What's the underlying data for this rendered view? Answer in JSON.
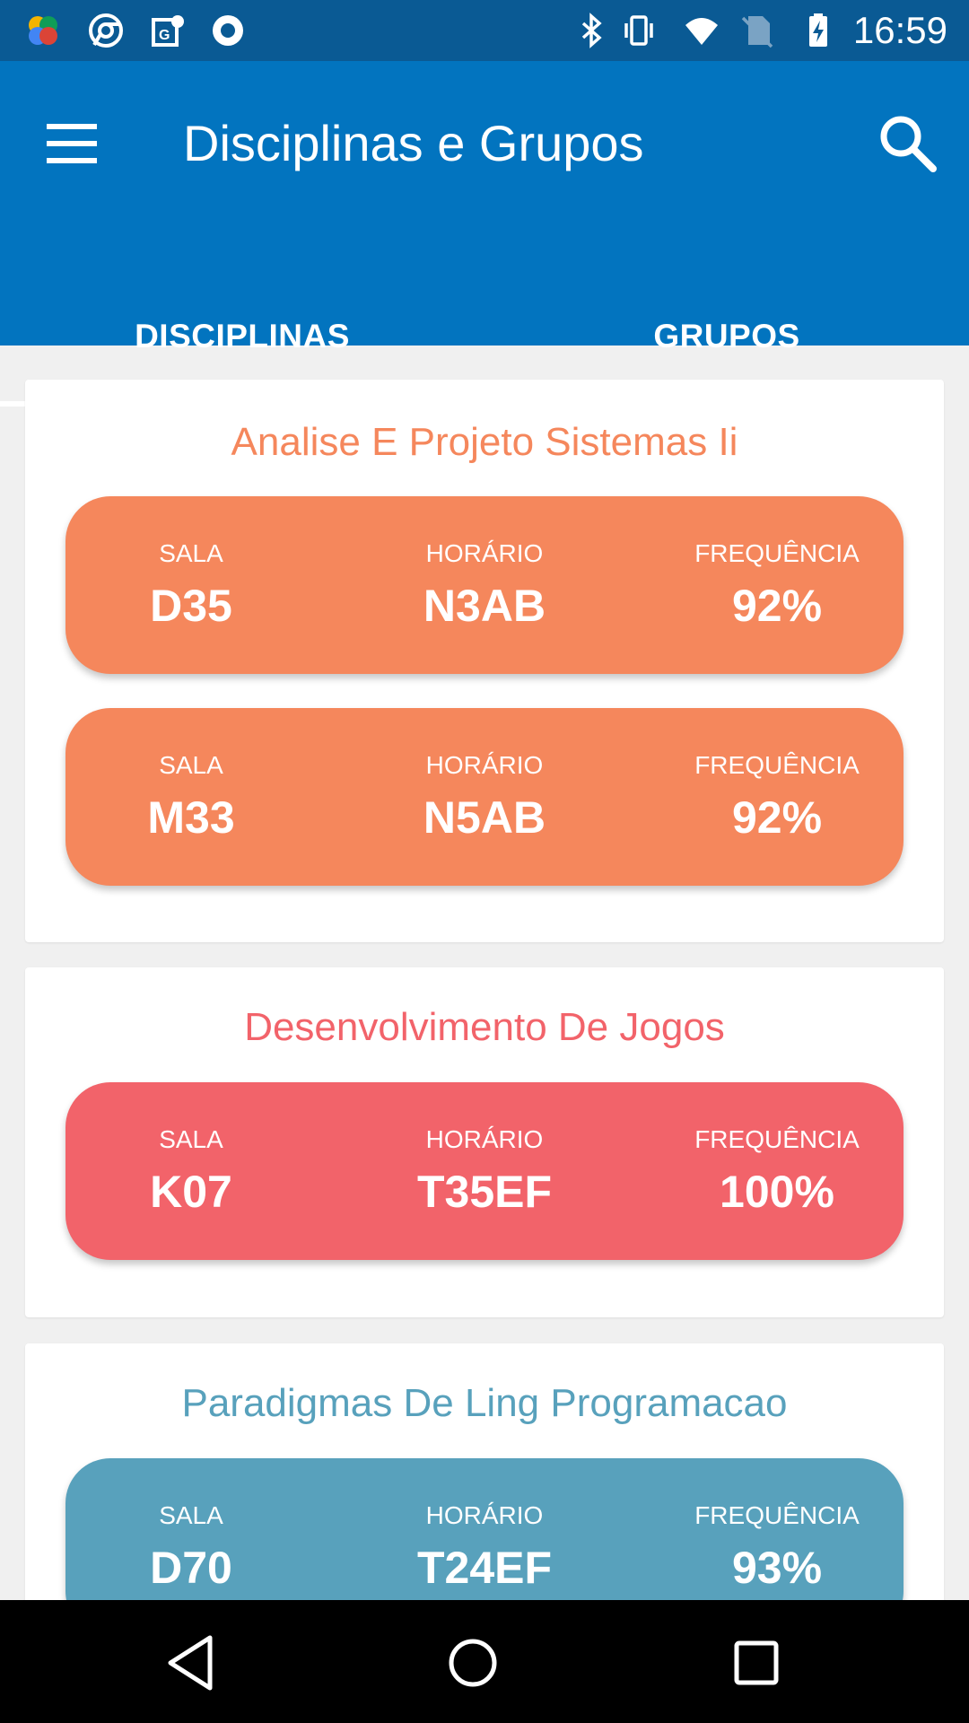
{
  "status_bar": {
    "time": "16:59",
    "left_icons": [
      "app-icon",
      "chrome-icon",
      "maps-icon",
      "record-icon"
    ],
    "right_icons": [
      "bluetooth-icon",
      "vibrate-icon",
      "wifi-icon",
      "no-sim-icon",
      "battery-icon"
    ]
  },
  "appbar": {
    "title": "Disciplinas e Grupos",
    "menu_icon": "menu-icon",
    "search_icon": "search-icon"
  },
  "tabs": [
    {
      "label": "DISCIPLINAS",
      "active": true
    },
    {
      "label": "GRUPOS",
      "active": false
    }
  ],
  "courses": [
    {
      "title": "Analise E Projeto Sistemas Ii",
      "color": "#f5875c",
      "slots": [
        {
          "sala_label": "SALA",
          "sala": "D35",
          "horario_label": "HORÁRIO",
          "horario": "N3AB",
          "frequencia_label": "FREQUÊNCIA",
          "frequencia": "92%"
        },
        {
          "sala_label": "SALA",
          "sala": "M33",
          "horario_label": "HORÁRIO",
          "horario": "N5AB",
          "frequencia_label": "FREQUÊNCIA",
          "frequencia": "92%"
        }
      ]
    },
    {
      "title": "Desenvolvimento De Jogos",
      "color": "#f2636a",
      "slots": [
        {
          "sala_label": "SALA",
          "sala": "K07",
          "horario_label": "HORÁRIO",
          "horario": "T35EF",
          "frequencia_label": "FREQUÊNCIA",
          "frequencia": "100%"
        }
      ]
    },
    {
      "title": "Paradigmas De Ling Programacao",
      "color": "#58a1bc",
      "slots": [
        {
          "sala_label": "SALA",
          "sala": "D70",
          "horario_label": "HORÁRIO",
          "horario": "T24EF",
          "frequencia_label": "FREQUÊNCIA",
          "frequencia": "93%"
        }
      ]
    }
  ],
  "navbar": {
    "icons": [
      "back-icon",
      "home-icon",
      "recents-icon"
    ]
  }
}
